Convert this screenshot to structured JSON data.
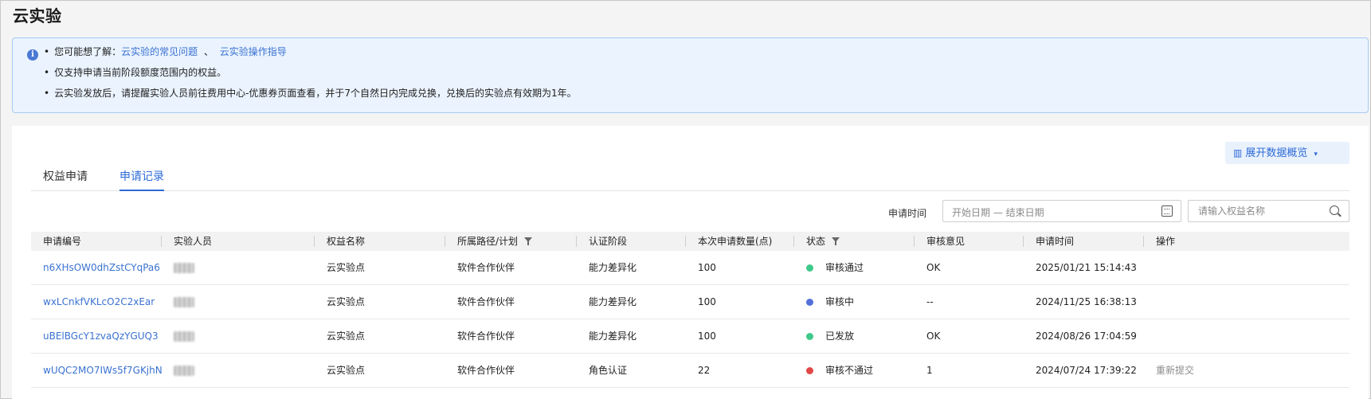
{
  "page": {
    "title": "云实验"
  },
  "notice": {
    "line1_prefix": "您可能想了解：",
    "link_faq": "云实验的常见问题",
    "separator": "、",
    "link_guide": "云实验操作指导",
    "line2": "仅支持申请当前阶段额度范围内的权益。",
    "line3": "云实验发放后，请提醒实验人员前往费用中心-优惠券页面查看，并于7个自然日内完成兑换，兑换后的实验点有效期为1年。"
  },
  "overview_button": {
    "label": "展开数据概览",
    "icon": "bar-chart-icon"
  },
  "tabs": [
    {
      "label": "权益申请",
      "active": false
    },
    {
      "label": "申请记录",
      "active": true
    }
  ],
  "filters": {
    "time_label": "申请时间",
    "date_placeholder": "开始日期 — 结束日期",
    "search_placeholder": "请输入权益名称"
  },
  "table": {
    "columns": [
      "申请编号",
      "实验人员",
      "权益名称",
      "所属路径/计划",
      "认证阶段",
      "本次申请数量(点)",
      "状态",
      "审核意见",
      "申请时间",
      "操作"
    ],
    "rows": [
      {
        "id": "n6XHsOW0dhZstCYqPa6",
        "entitlement": "云实验点",
        "path": "软件合作伙伴",
        "stage": "能力差异化",
        "quantity": "100",
        "status": "审核通过",
        "status_color": "#3ec98a",
        "opinion": "OK",
        "time": "2025/01/21 15:14:43",
        "action": ""
      },
      {
        "id": "wxLCnkfVKLcO2C2xEar",
        "entitlement": "云实验点",
        "path": "软件合作伙伴",
        "stage": "能力差异化",
        "quantity": "100",
        "status": "审核中",
        "status_color": "#5470d8",
        "opinion": "--",
        "time": "2024/11/25 16:38:13",
        "action": ""
      },
      {
        "id": "uBElBGcY1zvaQzYGUQ3",
        "entitlement": "云实验点",
        "path": "软件合作伙伴",
        "stage": "能力差异化",
        "quantity": "100",
        "status": "已发放",
        "status_color": "#3ec98a",
        "opinion": "OK",
        "time": "2024/08/26 17:04:59",
        "action": ""
      },
      {
        "id": "wUQC2MO7IWs5f7GKjhN",
        "entitlement": "云实验点",
        "path": "软件合作伙伴",
        "stage": "角色认证",
        "quantity": "22",
        "status": "审核不通过",
        "status_color": "#e04848",
        "opinion": "1",
        "time": "2024/07/24 17:39:22",
        "action": "重新提交"
      }
    ]
  }
}
